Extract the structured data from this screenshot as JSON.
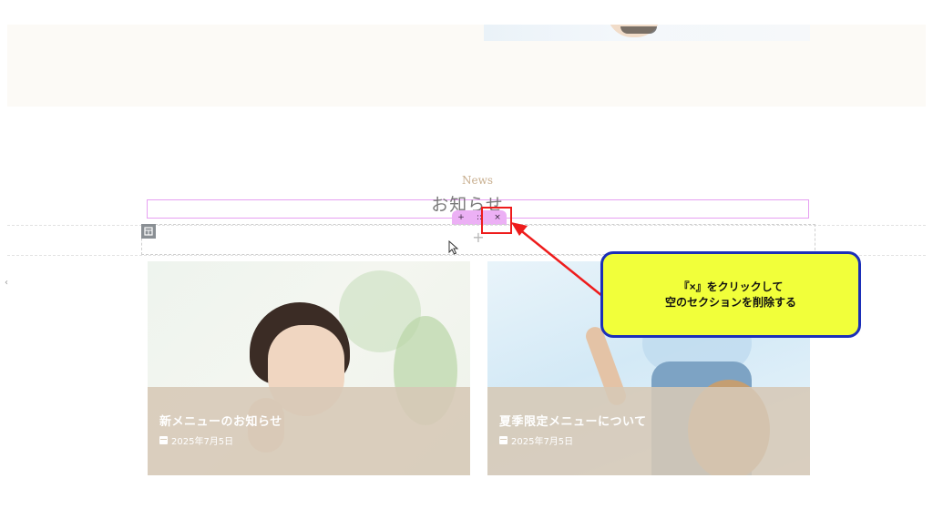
{
  "section": {
    "eyebrow": "News",
    "title": "お知らせ"
  },
  "toolbar": {
    "add": "+",
    "move": "::",
    "close": "×"
  },
  "empty_section": {
    "add_symbol": "+"
  },
  "cards": [
    {
      "title": "新メニューのお知らせ",
      "date": "2025年7月5日"
    },
    {
      "title": "夏季限定メニューについて",
      "date": "2025年7月5日"
    }
  ],
  "annotation": {
    "line1": "『×』をクリックして",
    "line2": "空のセクションを削除する"
  },
  "colors": {
    "accent_pink": "#ecb0f5",
    "annotation_red": "#ee1c1c",
    "callout_bg": "#f1ff3a",
    "callout_border": "#1b2fb8",
    "overlay": "#d6c8b6"
  },
  "icons": [
    "column-layout-icon",
    "plus-icon",
    "drag-handle-icon",
    "close-icon",
    "mouse-pointer-icon",
    "calendar-icon"
  ]
}
